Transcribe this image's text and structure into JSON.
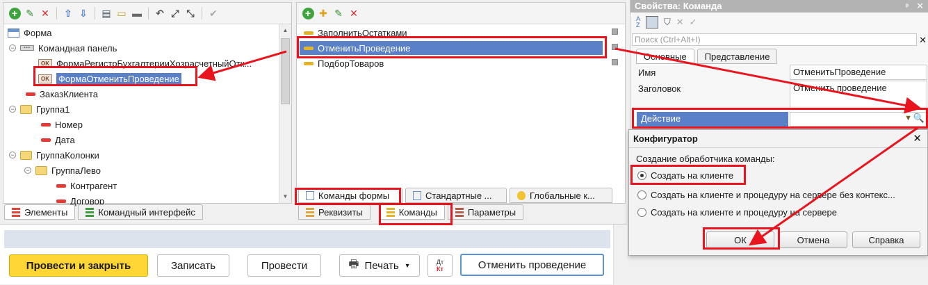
{
  "left_panel": {
    "tree": [
      {
        "label": "Форма"
      },
      {
        "label": "Командная панель"
      },
      {
        "label": "ФормаРегистрБухгалтерииХозрасчетныйОтк..."
      },
      {
        "label": "ФормаОтменитьПроведение"
      },
      {
        "label": "ЗаказКлиента"
      },
      {
        "label": "Группа1"
      },
      {
        "label": "Номер"
      },
      {
        "label": "Дата"
      },
      {
        "label": "ГруппаКолонки"
      },
      {
        "label": "ГруппаЛево"
      },
      {
        "label": "Контрагент"
      },
      {
        "label": "Договор"
      }
    ],
    "tabs": [
      {
        "label": "Элементы"
      },
      {
        "label": "Командный интерфейс"
      }
    ]
  },
  "middle_panel": {
    "commands": [
      {
        "label": "ЗаполнитьОстатками"
      },
      {
        "label": "ОтменитьПроведение"
      },
      {
        "label": "ПодборТоваров"
      }
    ],
    "sub_tabs": [
      {
        "label": "Команды формы"
      },
      {
        "label": "Стандартные ..."
      },
      {
        "label": "Глобальные к..."
      }
    ],
    "tabs": [
      {
        "label": "Реквизиты"
      },
      {
        "label": "Команды"
      },
      {
        "label": "Параметры"
      }
    ]
  },
  "properties": {
    "title": "Свойства: Команда",
    "search_placeholder": "Поиск (Ctrl+Alt+I)",
    "tabs": [
      {
        "label": "Основные"
      },
      {
        "label": "Представление"
      }
    ],
    "name_label": "Имя",
    "name_value": "ОтменитьПроведение",
    "caption_label": "Заголовок",
    "caption_value": "Отменить проведение",
    "action_label": "Действие"
  },
  "dialog": {
    "title": "Конфигуратор",
    "prompt": "Создание обработчика команды:",
    "options": [
      {
        "label": "Создать на клиенте",
        "selected": true
      },
      {
        "label": "Создать на клиенте и процедуру на сервере без контекс..."
      },
      {
        "label": "Создать на клиенте и процедуру на сервере"
      }
    ],
    "ok": "ОК",
    "cancel": "Отмена",
    "help": "Справка"
  },
  "form_preview": {
    "post_close": "Провести и закрыть",
    "save": "Записать",
    "post": "Провести",
    "print": "Печать",
    "dt_label": "Дт",
    "kt_label": "Кт",
    "unpost": "Отменить проведение"
  },
  "colors": {
    "highlight": "#e8141e",
    "selection": "#5a80c8",
    "primary_button": "#ffd633"
  }
}
